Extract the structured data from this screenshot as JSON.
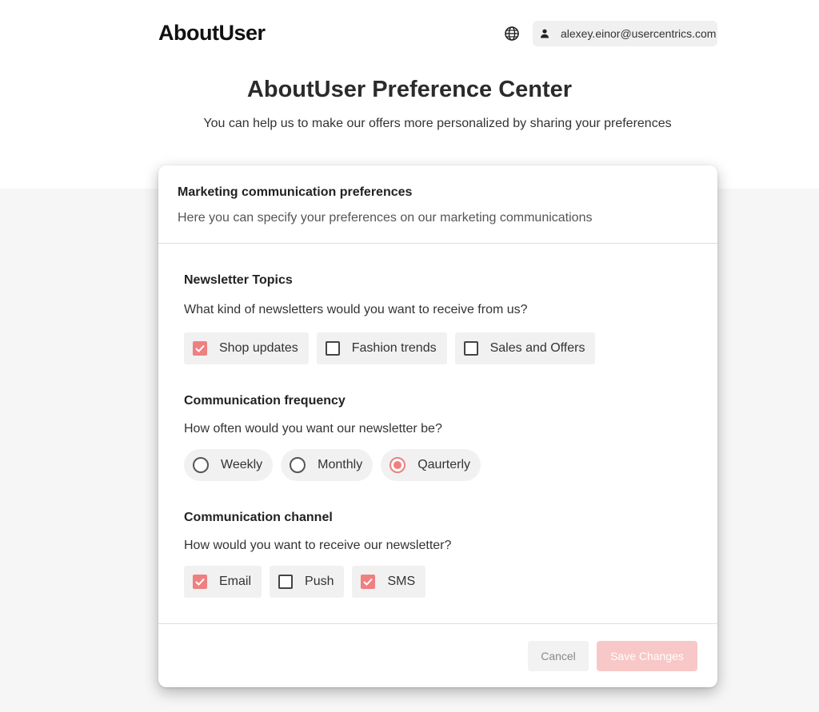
{
  "header": {
    "logo": "AboutUser",
    "user_email": "alexey.einor@usercentrics.com",
    "icons": {
      "language": "globe-icon",
      "user": "person-icon"
    }
  },
  "hero": {
    "title": "AboutUser Preference Center",
    "subtitle": "You can help us to make our offers more personalized by sharing your preferences"
  },
  "card": {
    "title": "Marketing communication preferences",
    "description": "Here you can specify your preferences on our marketing communications",
    "sections": [
      {
        "title": "Newsletter Topics",
        "question": "What kind of newsletters would you want to receive from us?",
        "type": "checkbox",
        "options": [
          {
            "label": "Shop updates",
            "checked": true
          },
          {
            "label": "Fashion trends",
            "checked": false
          },
          {
            "label": "Sales and Offers",
            "checked": false
          }
        ]
      },
      {
        "title": "Communication frequency",
        "question": "How often would you want our newsletter be?",
        "type": "radio",
        "options": [
          {
            "label": "Weekly",
            "checked": false
          },
          {
            "label": "Monthly",
            "checked": false
          },
          {
            "label": "Qaurterly",
            "checked": true
          }
        ]
      },
      {
        "title": "Communication channel",
        "question": "How would you want to receive our newsletter?",
        "type": "checkbox",
        "options": [
          {
            "label": "Email",
            "checked": true
          },
          {
            "label": "Push",
            "checked": false
          },
          {
            "label": "SMS",
            "checked": true
          }
        ]
      }
    ]
  },
  "footer": {
    "cancel_label": "Cancel",
    "save_label": "Save Changes"
  },
  "colors": {
    "accent": "#ee8080",
    "save_disabled": "#f8c7c7",
    "background_band": "#f6f6f6"
  }
}
